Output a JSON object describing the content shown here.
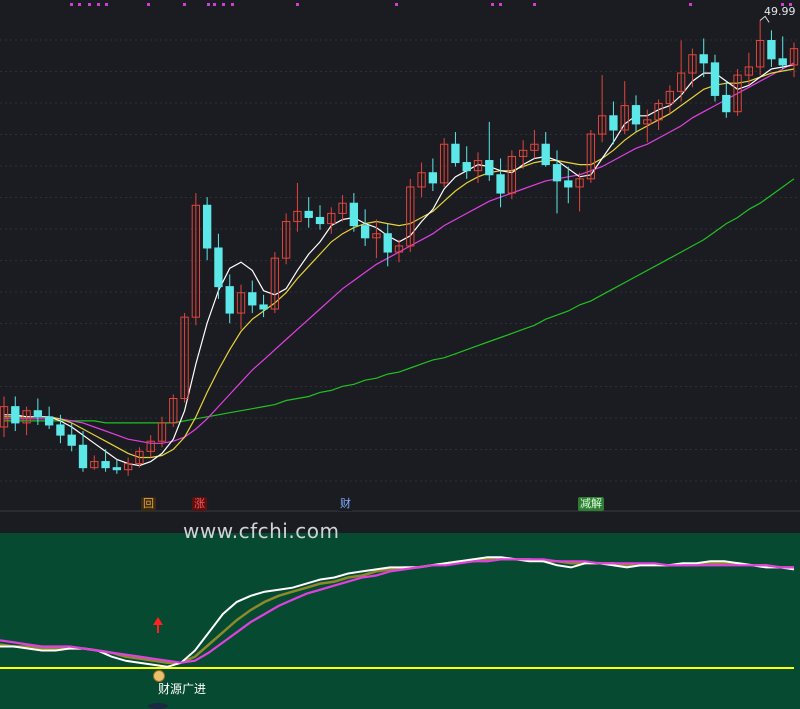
{
  "chart_data": {
    "type": "candlestick",
    "high_label": "49.99",
    "watermark": "www.cfchi.com",
    "tags": [
      {
        "text": "回",
        "color": "#e8a33d",
        "bg": "#3a2a10"
      },
      {
        "text": "涨",
        "color": "#ff5555",
        "bg": "#5a1010"
      },
      {
        "text": "财",
        "color": "#7fb0ff",
        "bg": "#1b1c22"
      },
      {
        "text": "减解",
        "color": "#d9ffd9",
        "bg": "#2e7d32"
      }
    ],
    "indicator_label": "财源广进",
    "colors": {
      "up": "#e0463c",
      "down": "#5ce8e8",
      "ma_white": "#ffffff",
      "ma_yellow": "#e6d33a",
      "ma_magenta": "#e040e0",
      "ma_green": "#22c022",
      "indicator_bg": "#064a32",
      "baseline": "#ffff00",
      "arrow": "#ff2020"
    },
    "candles": [
      [
        30,
        31.5,
        29.5,
        31
      ],
      [
        31,
        31.5,
        29.8,
        30.2
      ],
      [
        30.2,
        31,
        29.6,
        30.8
      ],
      [
        30.8,
        31.4,
        30.1,
        30.5
      ],
      [
        30.5,
        31,
        29.9,
        30.1
      ],
      [
        30.1,
        30.6,
        29.2,
        29.6
      ],
      [
        29.6,
        30.2,
        28.8,
        29.1
      ],
      [
        29.1,
        29.8,
        27.8,
        28.0
      ],
      [
        28.0,
        28.6,
        27.9,
        28.3
      ],
      [
        28.3,
        28.9,
        27.8,
        28.0
      ],
      [
        28.0,
        28.4,
        27.7,
        27.9
      ],
      [
        27.9,
        28.5,
        27.6,
        28.2
      ],
      [
        28.2,
        29.0,
        28.0,
        28.8
      ],
      [
        28.8,
        29.6,
        28.5,
        29.3
      ],
      [
        29.3,
        30.5,
        29.0,
        30.2
      ],
      [
        30.2,
        31.6,
        30.0,
        31.4
      ],
      [
        31.4,
        35.6,
        31.2,
        35.4
      ],
      [
        35.4,
        41.5,
        35.0,
        40.9
      ],
      [
        40.9,
        41.3,
        38.2,
        38.8
      ],
      [
        38.8,
        39.5,
        36.3,
        36.9
      ],
      [
        36.9,
        37.5,
        35.1,
        35.6
      ],
      [
        35.6,
        37.0,
        34.8,
        36.6
      ],
      [
        36.6,
        37.2,
        35.6,
        36.0
      ],
      [
        36.0,
        36.5,
        35.4,
        35.8
      ],
      [
        35.8,
        38.6,
        35.6,
        38.3
      ],
      [
        38.3,
        40.5,
        38.0,
        40.1
      ],
      [
        40.1,
        42.0,
        39.6,
        40.6
      ],
      [
        40.6,
        41.3,
        39.8,
        40.3
      ],
      [
        40.3,
        40.9,
        39.7,
        40.0
      ],
      [
        40.0,
        40.8,
        39.5,
        40.5
      ],
      [
        40.5,
        41.4,
        40.1,
        41.0
      ],
      [
        41.0,
        41.5,
        39.6,
        39.9
      ],
      [
        39.9,
        40.7,
        38.9,
        39.3
      ],
      [
        39.3,
        40.2,
        38.3,
        39.5
      ],
      [
        39.5,
        40.0,
        37.9,
        38.6
      ],
      [
        38.6,
        39.2,
        38.1,
        38.9
      ],
      [
        38.9,
        42.2,
        38.6,
        41.8
      ],
      [
        41.8,
        43.0,
        41.3,
        42.5
      ],
      [
        42.5,
        43.2,
        41.6,
        42.0
      ],
      [
        42.0,
        44.2,
        41.8,
        43.9
      ],
      [
        43.9,
        44.5,
        42.8,
        43.0
      ],
      [
        43.0,
        43.8,
        42.2,
        42.6
      ],
      [
        42.6,
        43.5,
        42.0,
        43.1
      ],
      [
        43.1,
        45.0,
        42.1,
        42.4
      ],
      [
        42.4,
        43.2,
        40.8,
        41.5
      ],
      [
        41.5,
        43.6,
        41.2,
        43.3
      ],
      [
        43.3,
        44.1,
        42.7,
        43.6
      ],
      [
        43.6,
        44.6,
        43.2,
        43.9
      ],
      [
        43.9,
        44.5,
        42.8,
        42.9
      ],
      [
        42.9,
        43.6,
        40.5,
        42.1
      ],
      [
        42.1,
        42.8,
        41.0,
        41.8
      ],
      [
        41.8,
        42.5,
        40.6,
        42.2
      ],
      [
        42.2,
        44.6,
        42.0,
        44.4
      ],
      [
        44.4,
        47.3,
        44.0,
        45.3
      ],
      [
        45.3,
        46.0,
        43.9,
        44.6
      ],
      [
        44.6,
        47.0,
        44.4,
        45.8
      ],
      [
        45.8,
        46.3,
        44.5,
        44.9
      ],
      [
        44.9,
        45.6,
        44.0,
        45.1
      ],
      [
        45.1,
        46.1,
        44.6,
        45.9
      ],
      [
        45.9,
        46.8,
        45.4,
        46.5
      ],
      [
        46.5,
        49.0,
        46.0,
        47.4
      ],
      [
        47.4,
        48.6,
        46.7,
        48.3
      ],
      [
        48.3,
        49.1,
        47.2,
        47.9
      ],
      [
        47.9,
        48.3,
        46.0,
        46.3
      ],
      [
        46.3,
        47.0,
        45.2,
        45.5
      ],
      [
        45.5,
        47.6,
        45.3,
        47.3
      ],
      [
        47.3,
        48.4,
        46.8,
        47.7
      ],
      [
        47.7,
        49.99,
        47.3,
        49.0
      ],
      [
        49.0,
        49.5,
        47.7,
        48.1
      ],
      [
        48.1,
        49.2,
        47.6,
        47.8
      ],
      [
        47.8,
        48.9,
        47.2,
        48.6
      ]
    ],
    "ma_white": [
      30.6,
      30.6,
      30.5,
      30.5,
      30.5,
      30.3,
      30.0,
      29.6,
      29.2,
      28.8,
      28.4,
      28.2,
      28.1,
      28.3,
      28.7,
      29.4,
      30.8,
      33.1,
      35.1,
      36.7,
      37.8,
      38.1,
      37.7,
      36.7,
      36.5,
      36.8,
      37.7,
      38.5,
      39.1,
      39.9,
      40.2,
      40.3,
      40.0,
      39.8,
      39.4,
      39.1,
      39.4,
      40.1,
      40.7,
      41.7,
      42.3,
      42.6,
      42.9,
      42.8,
      42.6,
      42.5,
      42.9,
      43.2,
      43.3,
      43.1,
      42.7,
      42.3,
      42.4,
      43.2,
      44.0,
      44.9,
      45.3,
      45.3,
      45.6,
      45.8,
      46.3,
      47.0,
      47.4,
      47.4,
      47.0,
      46.6,
      46.8,
      47.2,
      47.6,
      47.7,
      47.8
    ],
    "ma_yellow": [
      30.5,
      30.5,
      30.5,
      30.5,
      30.5,
      30.4,
      30.2,
      29.9,
      29.6,
      29.3,
      29.0,
      28.7,
      28.5,
      28.5,
      28.6,
      28.9,
      29.5,
      30.5,
      31.7,
      32.8,
      33.8,
      34.7,
      35.3,
      35.7,
      36.1,
      36.6,
      37.3,
      37.9,
      38.5,
      39.1,
      39.5,
      39.8,
      40.0,
      40.1,
      40.0,
      39.9,
      40.0,
      40.3,
      40.6,
      41.1,
      41.6,
      42.0,
      42.3,
      42.5,
      42.6,
      42.6,
      42.8,
      43.0,
      43.1,
      43.1,
      43.0,
      42.9,
      42.9,
      43.2,
      43.6,
      44.1,
      44.5,
      44.8,
      45.1,
      45.4,
      45.8,
      46.2,
      46.6,
      46.8,
      46.9,
      46.9,
      47.0,
      47.2,
      47.4,
      47.5,
      47.6
    ],
    "ma_magenta": [
      30.4,
      30.4,
      30.4,
      30.4,
      30.4,
      30.4,
      30.3,
      30.2,
      30.0,
      29.8,
      29.6,
      29.4,
      29.3,
      29.2,
      29.2,
      29.3,
      29.5,
      29.9,
      30.4,
      31.0,
      31.6,
      32.2,
      32.8,
      33.3,
      33.8,
      34.3,
      34.8,
      35.3,
      35.8,
      36.3,
      36.8,
      37.2,
      37.6,
      38.0,
      38.3,
      38.6,
      38.9,
      39.2,
      39.5,
      39.9,
      40.2,
      40.5,
      40.8,
      41.1,
      41.3,
      41.5,
      41.7,
      41.9,
      42.1,
      42.2,
      42.3,
      42.4,
      42.6,
      42.8,
      43.1,
      43.4,
      43.7,
      43.9,
      44.2,
      44.5,
      44.8,
      45.2,
      45.5,
      45.8,
      46.1,
      46.4,
      46.7,
      47.0,
      47.3,
      47.6,
      47.9
    ],
    "ma_green": [
      30.3,
      30.3,
      30.3,
      30.3,
      30.3,
      30.3,
      30.3,
      30.3,
      30.3,
      30.2,
      30.2,
      30.2,
      30.2,
      30.2,
      30.2,
      30.2,
      30.3,
      30.4,
      30.5,
      30.6,
      30.7,
      30.8,
      30.9,
      31.0,
      31.1,
      31.3,
      31.4,
      31.5,
      31.7,
      31.8,
      32.0,
      32.1,
      32.3,
      32.4,
      32.6,
      32.7,
      32.9,
      33.1,
      33.3,
      33.4,
      33.6,
      33.8,
      34.0,
      34.2,
      34.4,
      34.6,
      34.8,
      35.0,
      35.3,
      35.5,
      35.7,
      36.0,
      36.2,
      36.5,
      36.8,
      37.1,
      37.4,
      37.7,
      38.0,
      38.3,
      38.6,
      38.9,
      39.2,
      39.6,
      40.0,
      40.3,
      40.7,
      41.0,
      41.4,
      41.8,
      42.2
    ],
    "ind_white": [
      38,
      38,
      37,
      36,
      36,
      37,
      37,
      36,
      33,
      31,
      30,
      29,
      28,
      30,
      36,
      45,
      54,
      60,
      63,
      65,
      66,
      67,
      69,
      71,
      72,
      74,
      75,
      76,
      77,
      77,
      77,
      78,
      79,
      80,
      81,
      82,
      82,
      81,
      80,
      80,
      78,
      77,
      79,
      79,
      78,
      77,
      78,
      78,
      78,
      79,
      79,
      80,
      80,
      79,
      78,
      77,
      77,
      76
    ],
    "ind_olive": [
      39,
      38,
      38,
      37,
      37,
      37,
      37,
      36,
      35,
      33,
      32,
      31,
      30,
      30,
      33,
      39,
      45,
      51,
      56,
      60,
      63,
      65,
      67,
      69,
      70,
      72,
      73,
      75,
      76,
      77,
      77,
      78,
      79,
      80,
      80,
      81,
      81,
      81,
      81,
      80,
      80,
      79,
      79,
      79,
      79,
      78,
      78,
      78,
      78,
      78,
      78,
      79,
      79,
      79,
      78,
      78,
      77,
      77
    ],
    "ind_magenta": [
      41,
      40,
      39,
      38,
      38,
      38,
      37,
      36,
      35,
      34,
      33,
      32,
      31,
      30,
      31,
      35,
      40,
      45,
      50,
      54,
      58,
      61,
      64,
      66,
      68,
      70,
      72,
      73,
      75,
      76,
      77,
      78,
      78,
      79,
      80,
      80,
      81,
      81,
      81,
      81,
      80,
      80,
      80,
      79,
      79,
      79,
      79,
      79,
      78,
      78,
      78,
      78,
      78,
      78,
      78,
      78,
      77,
      77
    ]
  }
}
